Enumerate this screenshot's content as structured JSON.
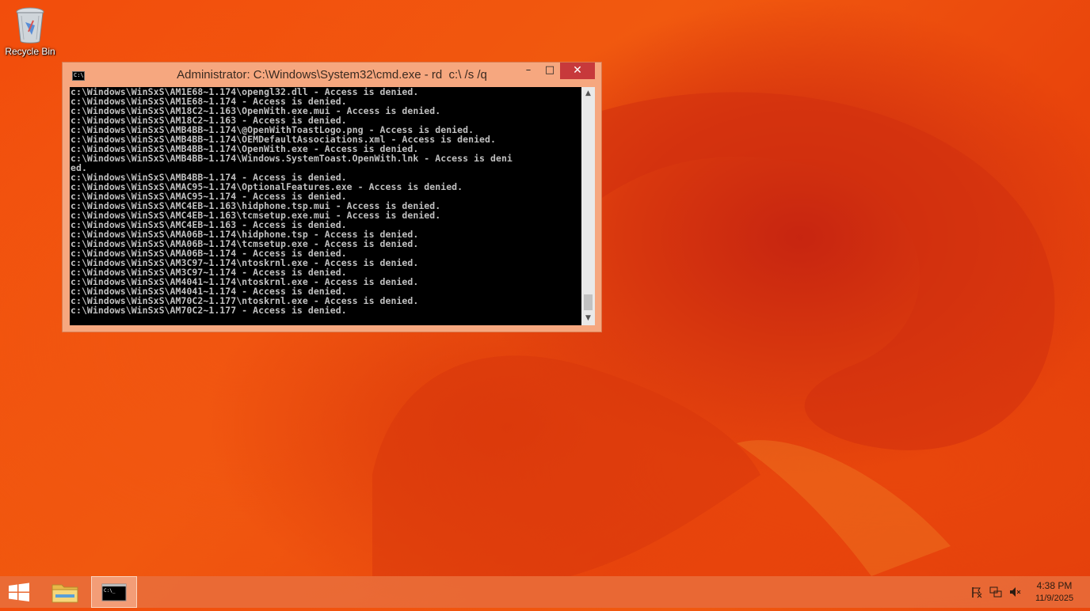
{
  "desktop": {
    "icons": [
      {
        "label": "Recycle Bin",
        "icon": "recycle-bin-icon"
      }
    ]
  },
  "window": {
    "title": "Administrator: C:\\Windows\\System32\\cmd.exe - rd  c:\\ /s /q",
    "icon": "cmd-icon",
    "icon_text": "C:\\",
    "controls": {
      "minimize": "–",
      "maximize": "□",
      "close": "✕"
    },
    "console_lines": [
      "c:\\Windows\\WinSxS\\AM1E68~1.174\\opengl32.dll - Access is denied.",
      "c:\\Windows\\WinSxS\\AM1E68~1.174 - Access is denied.",
      "c:\\Windows\\WinSxS\\AM18C2~1.163\\OpenWith.exe.mui - Access is denied.",
      "c:\\Windows\\WinSxS\\AM18C2~1.163 - Access is denied.",
      "c:\\Windows\\WinSxS\\AMB4BB~1.174\\@OpenWithToastLogo.png - Access is denied.",
      "c:\\Windows\\WinSxS\\AMB4BB~1.174\\OEMDefaultAssociations.xml - Access is denied.",
      "c:\\Windows\\WinSxS\\AMB4BB~1.174\\OpenWith.exe - Access is denied.",
      "c:\\Windows\\WinSxS\\AMB4BB~1.174\\Windows.SystemToast.OpenWith.lnk - Access is deni",
      "ed.",
      "c:\\Windows\\WinSxS\\AMB4BB~1.174 - Access is denied.",
      "c:\\Windows\\WinSxS\\AMAC95~1.174\\OptionalFeatures.exe - Access is denied.",
      "c:\\Windows\\WinSxS\\AMAC95~1.174 - Access is denied.",
      "c:\\Windows\\WinSxS\\AMC4EB~1.163\\hidphone.tsp.mui - Access is denied.",
      "c:\\Windows\\WinSxS\\AMC4EB~1.163\\tcmsetup.exe.mui - Access is denied.",
      "c:\\Windows\\WinSxS\\AMC4EB~1.163 - Access is denied.",
      "c:\\Windows\\WinSxS\\AMA06B~1.174\\hidphone.tsp - Access is denied.",
      "c:\\Windows\\WinSxS\\AMA06B~1.174\\tcmsetup.exe - Access is denied.",
      "c:\\Windows\\WinSxS\\AMA06B~1.174 - Access is denied.",
      "c:\\Windows\\WinSxS\\AM3C97~1.174\\ntoskrnl.exe - Access is denied.",
      "c:\\Windows\\WinSxS\\AM3C97~1.174 - Access is denied.",
      "c:\\Windows\\WinSxS\\AM4041~1.174\\ntoskrnl.exe - Access is denied.",
      "c:\\Windows\\WinSxS\\AM4041~1.174 - Access is denied.",
      "c:\\Windows\\WinSxS\\AM70C2~1.177\\ntoskrnl.exe - Access is denied.",
      "c:\\Windows\\WinSxS\\AM70C2~1.177 - Access is denied."
    ]
  },
  "taskbar": {
    "items": [
      {
        "name": "start",
        "icon": "windows-logo-icon"
      },
      {
        "name": "file-explorer",
        "icon": "folder-icon"
      },
      {
        "name": "command-prompt",
        "icon": "cmd-icon",
        "active": true
      }
    ],
    "tray": [
      {
        "icon": "action-center-flag-icon"
      },
      {
        "icon": "network-icon"
      },
      {
        "icon": "speaker-muted-icon"
      }
    ],
    "clock": {
      "time": "4:38 PM",
      "date": "11/9/2025"
    }
  },
  "colors": {
    "accent": "#f6a77f",
    "close_button": "#c7393b",
    "console_bg": "#000000",
    "console_fg": "#c0c0c0"
  }
}
